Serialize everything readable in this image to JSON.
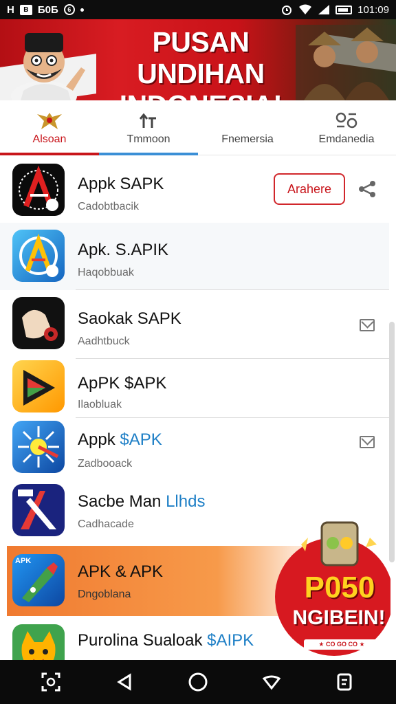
{
  "status_bar": {
    "left_1": "H",
    "left_2": "B",
    "left_3": "Б0Б",
    "left_4": "6",
    "time": "101:09"
  },
  "banner": {
    "title": "PUSAN UNDIHAN INDONESIA!"
  },
  "tabs": [
    {
      "label": "Alsoan",
      "icon": "garuda-emblem-icon",
      "active": true
    },
    {
      "label": "Tmmoon",
      "icon": "arrows-up-icon",
      "active": false
    },
    {
      "label": "Fnemersia",
      "icon": "",
      "active": false
    },
    {
      "label": "Emdanedia",
      "icon": "glyph-icon",
      "active": false
    }
  ],
  "apps": [
    {
      "name": "Appk SAPK",
      "sub": "Cadobtbacik",
      "action": "Arahere",
      "icon": "red-a-logo-icon"
    },
    {
      "name": "Apk. S.APIK",
      "sub": "Haqobbuak",
      "icon": "blue-a-logo-icon"
    },
    {
      "name": "Saokak SAPK",
      "sub": "Aadhtbuck",
      "icon": "hand-logo-icon"
    },
    {
      "name": "ApPK $APK",
      "sub": "Ilaobluak",
      "icon": "play-triangle-icon"
    },
    {
      "name_prefix": "Appk ",
      "name_accent": "$APK",
      "sub": "Zadbooack",
      "icon": "sun-burst-icon"
    },
    {
      "name_prefix": "Sacbe Man ",
      "name_accent": "Llhds",
      "sub": "Cadhacade",
      "icon": "red-x-logo-icon"
    },
    {
      "name": "APK & APK",
      "sub": "Dngoblana",
      "icon_label": "APK",
      "icon": "rocket-apk-icon"
    },
    {
      "name_prefix": "Purolina Sualoak ",
      "name_accent": "$AIPK",
      "sub": "",
      "icon": "cat-face-icon"
    }
  ],
  "promo": {
    "line1": "P050",
    "line2": "NGIBEIN!",
    "line3": "★ CO GO CO ★"
  },
  "colors": {
    "accent_red": "#c8151b",
    "accent_blue": "#1e7fc6",
    "promo_orange": "#f07a30"
  }
}
